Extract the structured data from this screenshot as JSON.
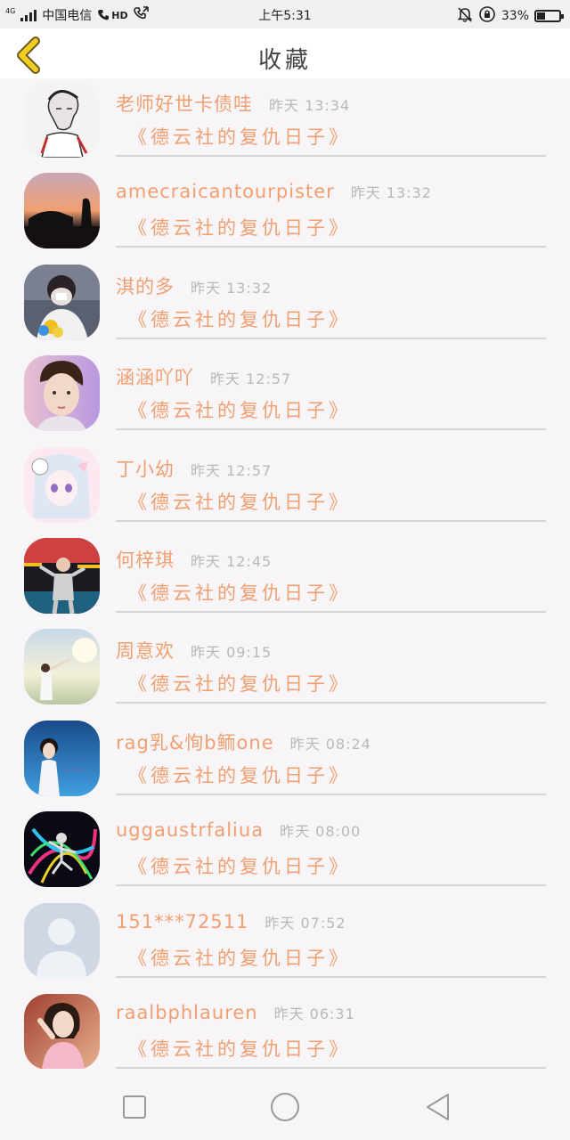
{
  "status_bar": {
    "network": "4G",
    "carrier": "中国电信",
    "hd": "HD",
    "time": "上午5:31",
    "battery_text": "33%",
    "battery_level": 0.33
  },
  "header": {
    "title": "收藏",
    "back_icon": "chevron-left-icon"
  },
  "colors": {
    "accent": "#f0a070",
    "back_arrow": "#e8c000",
    "time_text": "#b8b8b8"
  },
  "list": [
    {
      "name": "老师好世卡债哇",
      "time": "昨天 13:34",
      "book": "《德云社的复仇日子》",
      "avatar": "sketch-boy"
    },
    {
      "name": "amecraicantourpister",
      "time": "昨天 13:32",
      "book": "《德云社的复仇日子》",
      "avatar": "sunset-car"
    },
    {
      "name": "淇的多",
      "time": "昨天 13:32",
      "book": "《德云社的复仇日子》",
      "avatar": "masked-boy-flowers"
    },
    {
      "name": "涵涵吖吖",
      "time": "昨天 12:57",
      "book": "《德云社的复仇日子》",
      "avatar": "boy-portrait"
    },
    {
      "name": "丁小幼",
      "time": "昨天 12:57",
      "book": "《德云社的复仇日子》",
      "avatar": "anime-girl"
    },
    {
      "name": "何梓琪",
      "time": "昨天 12:45",
      "book": "《德云社的复仇日子》",
      "avatar": "stage-singer"
    },
    {
      "name": "周意欢",
      "time": "昨天 09:15",
      "book": "《德云社的复仇日子》",
      "avatar": "girl-field"
    },
    {
      "name": "rag乳&恂b鲕one",
      "time": "昨天 08:24",
      "book": "《德云社的复仇日子》",
      "avatar": "girl-blue"
    },
    {
      "name": "uggaustrfaliua",
      "time": "昨天 08:00",
      "book": "《德云社的复仇日子》",
      "avatar": "neon-dancer"
    },
    {
      "name": "151***72511",
      "time": "昨天 07:52",
      "book": "《德云社的复仇日子》",
      "avatar": "default-person"
    },
    {
      "name": "raalbphlauren",
      "time": "昨天 06:31",
      "book": "《德云社的复仇日子》",
      "avatar": "woman-pink"
    }
  ],
  "nav_bar": {
    "recent_icon": "square-icon",
    "home_icon": "circle-icon",
    "back_icon": "triangle-back-icon"
  }
}
